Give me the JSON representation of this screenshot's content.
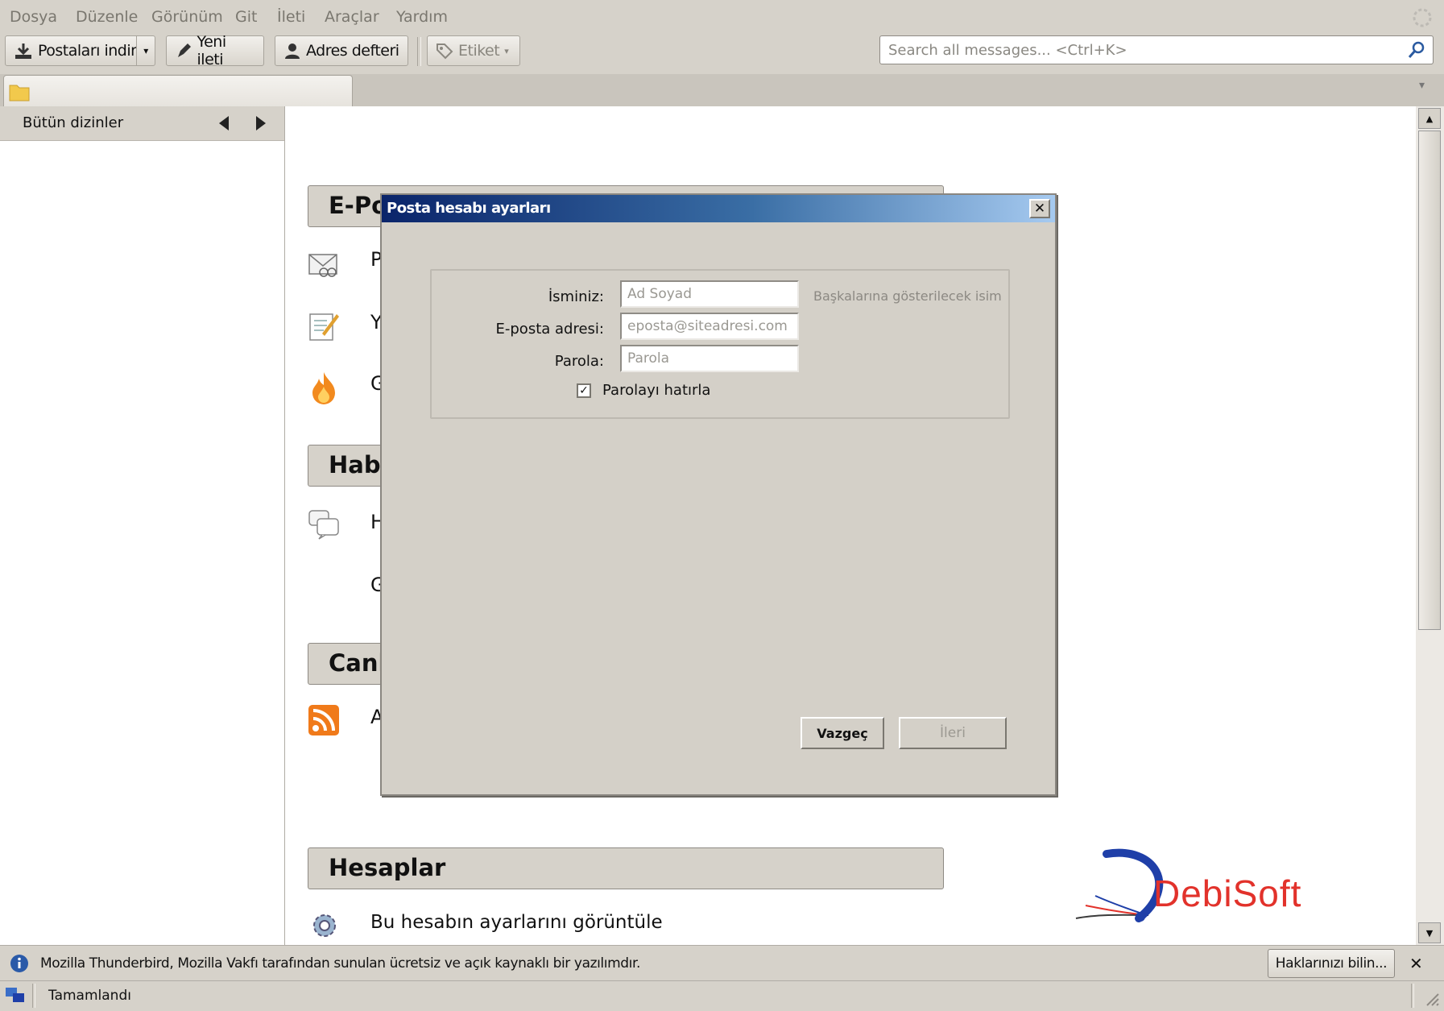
{
  "menu": [
    "Dosya",
    "Düzenle",
    "Görünüm",
    "Git",
    "İleti",
    "Araçlar",
    "Yardım"
  ],
  "toolbar": {
    "get_mail": "Postaları indir",
    "new_message": "Yeni ileti",
    "address_book": "Adres defteri",
    "tag": "Etiket"
  },
  "search": {
    "placeholder": "Search all messages... <Ctrl+K>"
  },
  "sidebar": {
    "folders_label": "Bütün dizinler"
  },
  "content": {
    "sections": [
      {
        "header": "E-Po",
        "rows": [
          "P",
          "Y",
          "G"
        ]
      },
      {
        "header": "Hab",
        "rows": [
          "H",
          "G"
        ]
      },
      {
        "header": "Canl",
        "rows": [
          "A"
        ]
      },
      {
        "header": "Hesaplar",
        "rows": [
          "Bu hesabın ayarlarını görüntüle"
        ]
      }
    ],
    "logo_text": "DebiSoft"
  },
  "dialog": {
    "title": "Posta hesabı ayarları",
    "name_label": "İsminiz:",
    "name_value": "Ad Soyad",
    "name_hint": "Başkalarına gösterilecek isim",
    "email_label": "E-posta adresi:",
    "email_value": "eposta@siteadresi.com",
    "password_label": "Parola:",
    "password_value": "Parola",
    "remember_label": "Parolayı hatırla",
    "remember_checked": true,
    "cancel_label": "Vazgeç",
    "next_label": "İleri"
  },
  "infobar": {
    "message": "Mozilla Thunderbird, Mozilla Vakfı tarafından sunulan ücretsiz ve açık kaynaklı bir yazılımdır.",
    "rights_button": "Haklarınızı bilin..."
  },
  "status": {
    "text": "Tamamlandı"
  },
  "colors": {
    "title_start": "#0a246a",
    "title_end": "#a6caf0",
    "logo_blue": "#1f3fa8",
    "logo_red": "#e2322b"
  }
}
